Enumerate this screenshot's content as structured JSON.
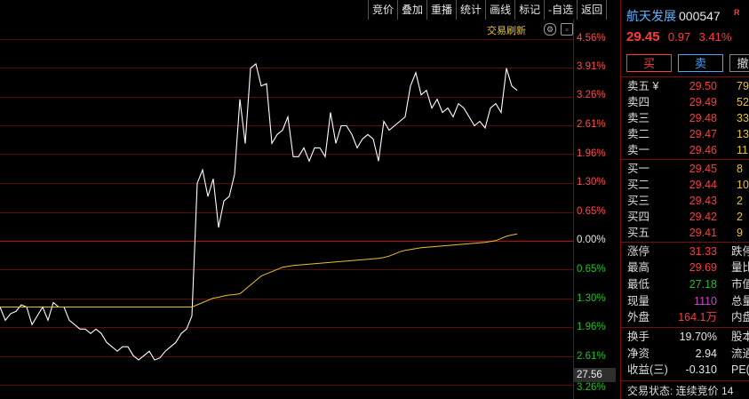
{
  "toolbar": [
    "竞价",
    "叠加",
    "重播",
    "统计",
    "画线",
    "标记",
    "-自选",
    "返回"
  ],
  "chart": {
    "refresh_label": "交易刷新",
    "icons": [
      "settings-icon",
      "window-icon"
    ],
    "axis_labels": [
      {
        "text": "4.56%",
        "color": "#ff4b4b"
      },
      {
        "text": "3.91%",
        "color": "#ff4b4b"
      },
      {
        "text": "3.26%",
        "color": "#ff4b4b"
      },
      {
        "text": "2.61%",
        "color": "#ff4b4b"
      },
      {
        "text": "1.96%",
        "color": "#ff4b4b"
      },
      {
        "text": "1.30%",
        "color": "#ff4b4b"
      },
      {
        "text": "0.65%",
        "color": "#ff4b4b"
      },
      {
        "text": "0.00%",
        "color": "#e6e6e6"
      },
      {
        "text": "0.65%",
        "color": "#20c020"
      },
      {
        "text": "1.30%",
        "color": "#20c020"
      },
      {
        "text": "1.96%",
        "color": "#20c020"
      },
      {
        "text": "2.61%",
        "color": "#20c020"
      },
      {
        "text": "3.26%",
        "color": "#20c020"
      }
    ],
    "price_tag": "27.56"
  },
  "chart_data": {
    "type": "line",
    "ylim": [
      -3.26,
      4.56
    ],
    "series": [
      {
        "color": "#ffffff",
        "values": [
          -1.5,
          -1.8,
          -1.65,
          -1.6,
          -1.45,
          -1.5,
          -1.9,
          -1.7,
          -1.5,
          -1.8,
          -1.4,
          -1.5,
          -1.5,
          -1.8,
          -1.9,
          -2.0,
          -2.0,
          -2.1,
          -2.0,
          -2.1,
          -2.3,
          -2.4,
          -2.5,
          -2.4,
          -2.4,
          -2.6,
          -2.7,
          -2.6,
          -2.5,
          -2.7,
          -2.65,
          -2.5,
          -2.4,
          -2.3,
          -2.1,
          -2.0,
          -1.7,
          1.3,
          1.6,
          1.0,
          1.4,
          0.3,
          0.9,
          1.0,
          1.5,
          3.2,
          2.2,
          3.9,
          4.0,
          3.5,
          3.55,
          2.2,
          2.4,
          2.5,
          2.8,
          1.9,
          1.9,
          2.1,
          1.8,
          2.1,
          2.1,
          1.9,
          2.9,
          2.2,
          2.6,
          2.6,
          2.4,
          2.1,
          2.3,
          2.4,
          2.3,
          1.8,
          2.7,
          2.5,
          2.6,
          2.7,
          2.8,
          3.5,
          3.8,
          3.3,
          3.4,
          3.0,
          3.2,
          2.9,
          3.0,
          2.8,
          3.1,
          3.0,
          2.8,
          2.6,
          2.7,
          2.55,
          3.0,
          3.1,
          2.9,
          3.9,
          3.5,
          3.4
        ],
        "x_count": 98,
        "step_px": 6
      },
      {
        "color": "#e8c230",
        "values": [
          -1.5,
          -1.5,
          -1.5,
          -1.5,
          -1.5,
          -1.5,
          -1.5,
          -1.5,
          -1.5,
          -1.5,
          -1.5,
          -1.5,
          -1.5,
          -1.5,
          -1.5,
          -1.5,
          -1.5,
          -1.5,
          -1.5,
          -1.5,
          -1.5,
          -1.5,
          -1.5,
          -1.5,
          -1.5,
          -1.5,
          -1.5,
          -1.5,
          -1.5,
          -1.5,
          -1.5,
          -1.5,
          -1.5,
          -1.5,
          -1.5,
          -1.5,
          -1.5,
          -1.45,
          -1.4,
          -1.35,
          -1.3,
          -1.28,
          -1.25,
          -1.23,
          -1.22,
          -1.2,
          -1.1,
          -1.0,
          -0.9,
          -0.8,
          -0.75,
          -0.7,
          -0.65,
          -0.6,
          -0.58,
          -0.56,
          -0.55,
          -0.54,
          -0.53,
          -0.52,
          -0.51,
          -0.5,
          -0.49,
          -0.48,
          -0.47,
          -0.46,
          -0.45,
          -0.44,
          -0.43,
          -0.42,
          -0.41,
          -0.4,
          -0.38,
          -0.35,
          -0.3,
          -0.25,
          -0.22,
          -0.2,
          -0.18,
          -0.16,
          -0.15,
          -0.14,
          -0.13,
          -0.12,
          -0.11,
          -0.1,
          -0.09,
          -0.08,
          -0.07,
          -0.06,
          -0.05,
          -0.04,
          -0.02,
          0.0,
          0.05,
          0.1,
          0.13,
          0.15
        ],
        "x_count": 98,
        "step_px": 6
      }
    ]
  },
  "stock": {
    "name": "航天发展",
    "code": "000547",
    "badge": "R",
    "price": "29.45",
    "change": "0.97",
    "pct": "3.41%"
  },
  "buttons": {
    "buy": "买",
    "sell": "卖",
    "third": "撤"
  },
  "asks": [
    {
      "label": "卖五 ¥",
      "price": "29.50",
      "vol": "79"
    },
    {
      "label": "卖四",
      "price": "29.49",
      "vol": "52"
    },
    {
      "label": "卖三",
      "price": "29.48",
      "vol": "33"
    },
    {
      "label": "卖二",
      "price": "29.47",
      "vol": "13"
    },
    {
      "label": "卖一",
      "price": "29.46",
      "vol": "11"
    }
  ],
  "bids": [
    {
      "label": "买一",
      "price": "29.45",
      "vol": "8"
    },
    {
      "label": "买二",
      "price": "29.44",
      "vol": "10"
    },
    {
      "label": "买三",
      "price": "29.43",
      "vol": "2"
    },
    {
      "label": "买四",
      "price": "29.42",
      "vol": "2"
    },
    {
      "label": "买五",
      "price": "29.41",
      "vol": "9"
    }
  ],
  "info1": [
    {
      "label": "涨停",
      "value": "31.33",
      "color": "#ff3b3b",
      "label2": "跌停"
    },
    {
      "label": "最高",
      "value": "29.69",
      "color": "#ff3b3b",
      "label2": "量比"
    },
    {
      "label": "最低",
      "value": "27.18",
      "color": "#20c020",
      "label2": "市值"
    },
    {
      "label": "现量",
      "value": "1110",
      "color": "#d040d0",
      "label2": "总量"
    },
    {
      "label": "外盘",
      "value": "164.1万",
      "color": "#ff3b3b",
      "label2": "内盘"
    }
  ],
  "info2": [
    {
      "label": "换手",
      "value": "19.70%",
      "color": "#e6e6e6",
      "label2": "股本"
    },
    {
      "label": "净资",
      "value": "2.94",
      "color": "#e6e6e6",
      "label2": "流通"
    },
    {
      "label": "收益(三)",
      "value": "-0.310",
      "color": "#e6e6e6",
      "label2": "PE(动"
    }
  ],
  "status": {
    "text": "交易状态: 连续竞价",
    "value": "14"
  }
}
